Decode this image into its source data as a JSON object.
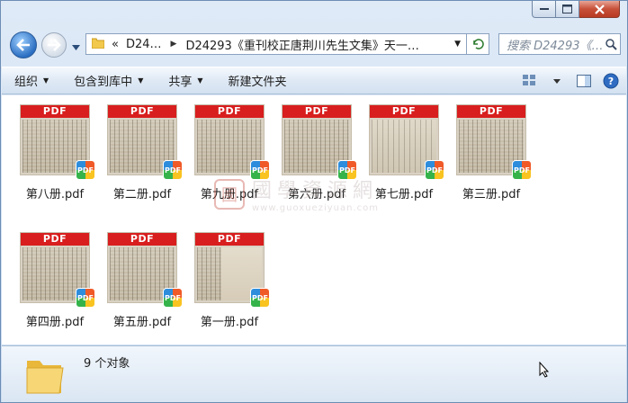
{
  "address": {
    "root_chevron": "«",
    "segments": [
      "D24…",
      "D24293《重刊校正唐荆川先生文集》天一…"
    ]
  },
  "search": {
    "placeholder": "搜索 D24293《…"
  },
  "toolbar": {
    "organize": "组织",
    "include_in_library": "包含到库中",
    "share": "共享",
    "new_folder": "新建文件夹"
  },
  "files": [
    {
      "name": "第八册.pdf",
      "label": "PDF",
      "badge": "PDF"
    },
    {
      "name": "第二册.pdf",
      "label": "PDF",
      "badge": "PDF"
    },
    {
      "name": "第九册.pdf",
      "label": "PDF",
      "badge": "PDF"
    },
    {
      "name": "第六册.pdf",
      "label": "PDF",
      "badge": "PDF"
    },
    {
      "name": "第七册.pdf",
      "label": "PDF",
      "badge": "PDF"
    },
    {
      "name": "第三册.pdf",
      "label": "PDF",
      "badge": "PDF"
    },
    {
      "name": "第四册.pdf",
      "label": "PDF",
      "badge": "PDF"
    },
    {
      "name": "第五册.pdf",
      "label": "PDF",
      "badge": "PDF"
    },
    {
      "name": "第一册.pdf",
      "label": "PDF",
      "badge": "PDF"
    }
  ],
  "watermark": {
    "seal": "國",
    "chinese": "國學資源網",
    "url": "www.guoxueziyuan.com"
  },
  "status": {
    "count_text": "9 个对象"
  },
  "colors": {
    "pdf_red": "#d81e1e",
    "close_red": "#c75039",
    "folder_yellow": "#f2c94c"
  },
  "icons": [
    "back-arrow-icon",
    "forward-arrow-icon",
    "folder-icon",
    "refresh-icon",
    "search-icon",
    "view-options-icon",
    "preview-pane-icon",
    "help-icon",
    "pdf-app-icon"
  ]
}
